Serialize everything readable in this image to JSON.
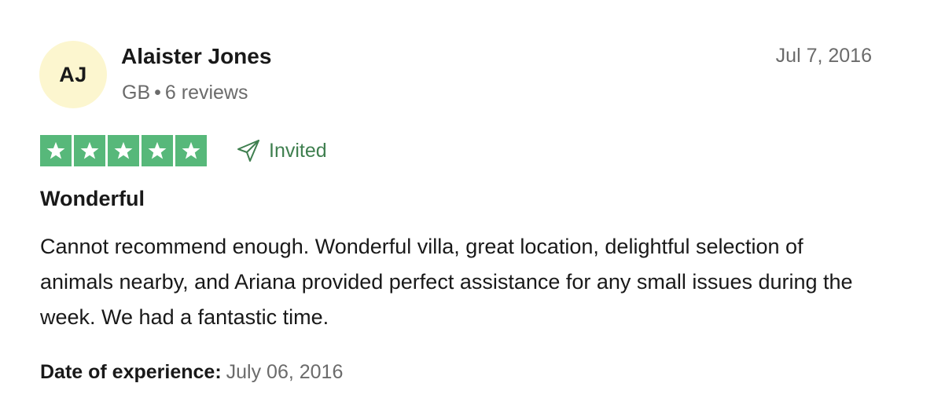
{
  "reviewer": {
    "initials": "AJ",
    "name": "Alaister Jones",
    "country": "GB",
    "separator": "•",
    "reviews_count": "6 reviews"
  },
  "review": {
    "date": "Jul 7, 2016",
    "rating": 5,
    "rating_max": 5,
    "badge": "Invited",
    "title": "Wonderful",
    "body": "Cannot recommend enough. Wonderful villa, great location, delightful selection of animals nearby, and Ariana provided perfect assistance for any small issues during the week. We had a fantastic time.",
    "experience_label": "Date of experience:",
    "experience_date": "July 06, 2016"
  },
  "colors": {
    "star_green": "#57b87a",
    "avatar_bg": "#fcf6cf",
    "invited_green": "#3f7f4f",
    "muted_text": "#6b6b6b"
  },
  "icons": {
    "star": "star-icon",
    "invited": "paper-plane-icon"
  }
}
